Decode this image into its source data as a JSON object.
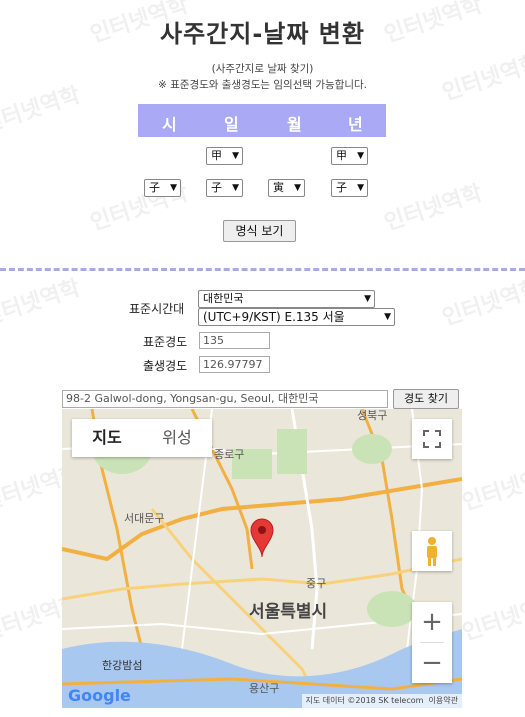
{
  "watermark": "인터넷역학",
  "title": "사주간지-날짜 변환",
  "subtitle": "(사주간지로 날짜 찾기)",
  "note": "※ 표준경도와 출생경도는 임의선택 가능합니다.",
  "pillars": {
    "headers": [
      "시",
      "일",
      "월",
      "년"
    ],
    "row1": {
      "day": "甲",
      "year": "甲"
    },
    "row2": {
      "hour": "子",
      "day": "子",
      "month": "寅",
      "year": "子"
    }
  },
  "view_button": "명식 보기",
  "form": {
    "timezone_label": "표준시간대",
    "country": "대한민국",
    "timezone": "(UTC+9/KST) E.135 서울",
    "std_longitude_label": "표준경도",
    "std_longitude": "135",
    "birth_longitude_label": "출생경도",
    "birth_longitude": "126.97797"
  },
  "address": {
    "value": "98-2 Galwol-dong, Yongsan-gu, Seoul, 대한민국",
    "button": "경도 찾기"
  },
  "map": {
    "tab_map": "지도",
    "tab_satellite": "위성",
    "zoom_in": "+",
    "zoom_out": "−",
    "city_label": "서울특별시",
    "places": [
      "성북구",
      "종로구",
      "서대문구",
      "중구",
      "한강밤섬",
      "용산구"
    ],
    "attribution": "지도 데이터 ©2018 SK telecom",
    "terms": "이용약관",
    "google": "Google"
  }
}
